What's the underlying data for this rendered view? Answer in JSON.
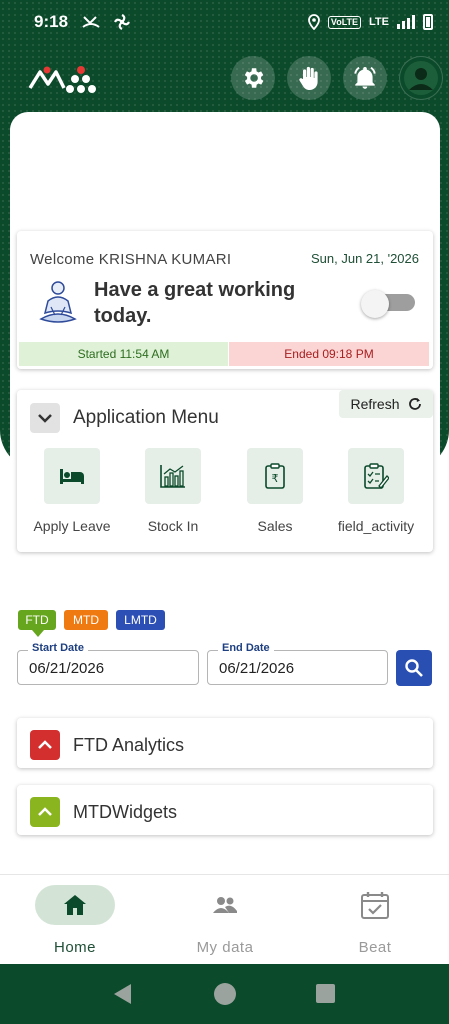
{
  "status_bar": {
    "time": "9:18",
    "network_badge": "VoLTE",
    "network_type": "LTE"
  },
  "header": {
    "logo_icon": "brand-logo",
    "icons": [
      "settings-icon",
      "hand-icon",
      "notification-bell-icon",
      "profile-avatar-icon"
    ]
  },
  "welcome": {
    "greeting": "Welcome KRISHNA KUMARI",
    "date": "Sun, Jun 21, '2026",
    "message": "Have a great working today.",
    "toggle_on": false,
    "started": "Started 11:54 AM",
    "ended": "Ended 09:18 PM"
  },
  "app_menu": {
    "title": "Application Menu",
    "refresh_label": "Refresh",
    "items": [
      {
        "label": "Apply Leave",
        "icon": "bed-icon"
      },
      {
        "label": "Stock In",
        "icon": "bar-chart-icon"
      },
      {
        "label": "Sales",
        "icon": "sales-doc-icon"
      },
      {
        "label": "field_activity",
        "icon": "clipboard-icon"
      }
    ]
  },
  "filters": {
    "chips": [
      "FTD",
      "MTD",
      "LMTD"
    ],
    "active_chip": "FTD",
    "start_date_label": "Start Date",
    "start_date": "06/21/2026",
    "end_date_label": "End Date",
    "end_date": "06/21/2026"
  },
  "sections": [
    {
      "title": "FTD Analytics",
      "color": "#d32f2f"
    },
    {
      "title": "MTDWidgets",
      "color": "#8bb51e"
    }
  ],
  "bottom_nav": {
    "items": [
      {
        "label": "Home",
        "icon": "home-icon",
        "active": true
      },
      {
        "label": "My data",
        "icon": "people-icon",
        "active": false
      },
      {
        "label": "Beat",
        "icon": "calendar-check-icon",
        "active": false
      }
    ]
  },
  "colors": {
    "primary_green": "#0b4a2a",
    "accent_blue": "#2a4fb3"
  }
}
